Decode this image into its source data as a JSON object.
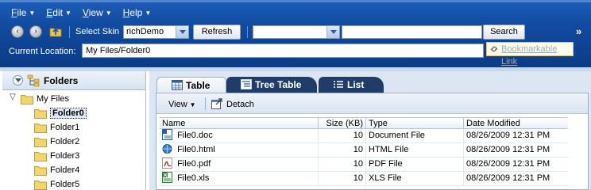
{
  "menus": [
    {
      "label": "File"
    },
    {
      "label": "Edit"
    },
    {
      "label": "View"
    },
    {
      "label": "Help"
    }
  ],
  "toolbar": {
    "skin_label": "Select Skin",
    "skin_value": "richDemo",
    "refresh_label": "Refresh",
    "search_scope_value": "",
    "search_value": "",
    "search_label": "Search"
  },
  "location": {
    "label": "Current Location:",
    "value": "My Files/Folder0",
    "bookmark_label": "Bookmarkable Link"
  },
  "folders_panel": {
    "title": "Folders",
    "root": "My Files",
    "items": [
      "Folder0",
      "Folder1",
      "Folder2",
      "Folder3",
      "Folder4",
      "Folder5"
    ],
    "selected": "Folder0"
  },
  "tabs": [
    {
      "label": "Table",
      "active": true
    },
    {
      "label": "Tree Table",
      "active": false
    },
    {
      "label": "List",
      "active": false
    }
  ],
  "content_toolbar": {
    "view_label": "View",
    "detach_label": "Detach"
  },
  "table": {
    "columns": [
      "Name",
      "Size (KB)",
      "Type",
      "Date Modified"
    ],
    "rows": [
      {
        "icon": "word-doc-icon",
        "name": "File0.doc",
        "size": "10",
        "type": "Document File",
        "date": "08/26/2009 12:31 PM"
      },
      {
        "icon": "html-file-icon",
        "name": "File0.html",
        "size": "10",
        "type": "HTML File",
        "date": "08/26/2009 12:31 PM"
      },
      {
        "icon": "pdf-file-icon",
        "name": "File0.pdf",
        "size": "10",
        "type": "PDF File",
        "date": "08/26/2009 12:31 PM"
      },
      {
        "icon": "excel-file-icon",
        "name": "File0.xls",
        "size": "10",
        "type": "XLS File",
        "date": "08/26/2009 12:31 PM"
      }
    ]
  },
  "colors": {
    "chrome_blue": "#114a9f",
    "tab_dark": "#1f3d68",
    "panel_bg": "#dce6f3"
  }
}
